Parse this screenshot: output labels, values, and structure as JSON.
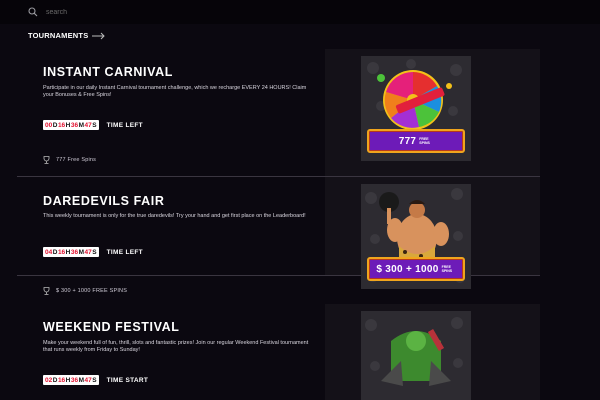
{
  "search": {
    "placeholder": "search"
  },
  "section": {
    "title": "TOURNAMENTS"
  },
  "tournaments": [
    {
      "title": "INSTANT CARNIVAL",
      "description": "Participate in our daily Instant Carnival tournament challenge, which we recharge EVERY 24 HOURS! Claim your Bonuses & Free Spins!",
      "timer": {
        "d": "00",
        "h": "16",
        "m": "36",
        "s": "47"
      },
      "timer_label": "TIME LEFT",
      "prize": "777 Free Spins",
      "banner": {
        "amount": "777",
        "sub": "FREE SPINS"
      },
      "accent": "#e0b21b"
    },
    {
      "title": "DAREDEVILS FAIR",
      "description": "This weekly tournament is only for the true daredevils! Try your hand and get first place on the Leaderboard!",
      "timer": {
        "d": "04",
        "h": "16",
        "m": "36",
        "s": "47"
      },
      "timer_label": "TIME LEFT",
      "prize": "$ 300 + 1000 FREE SPINS",
      "banner": {
        "amount": "$ 300 + 1000",
        "sub": "FREE SPINS"
      },
      "accent": "#c98a4a"
    },
    {
      "title": "WEEKEND FESTIVAL",
      "description": "Make your weekend full of fun, thrill, slots and fantastic prizes! Join our regular Weekend Festival tournament that runs weekly from Friday to Sunday!",
      "timer": {
        "d": "02",
        "h": "16",
        "m": "36",
        "s": "47"
      },
      "timer_label": "TIME START",
      "prize": "",
      "banner": {
        "amount": "",
        "sub": ""
      },
      "accent": "#4aa33a"
    }
  ]
}
